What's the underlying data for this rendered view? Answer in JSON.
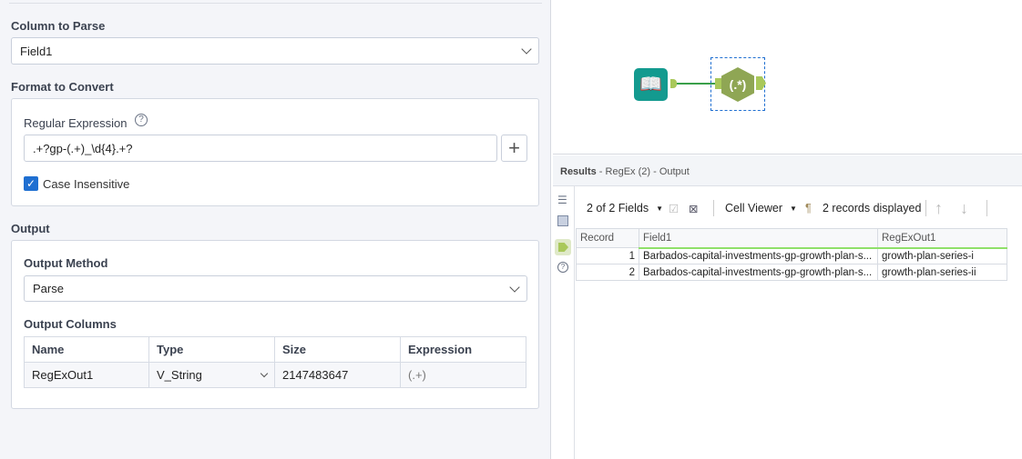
{
  "config": {
    "column_to_parse_label": "Column to Parse",
    "column_to_parse_value": "Field1",
    "format_label": "Format to Convert",
    "regex_label": "Regular Expression",
    "regex_value": ".+?gp-(.+)_\\d{4}.+?",
    "case_insensitive_label": "Case Insensitive",
    "case_insensitive_checked": true,
    "output_label": "Output",
    "output_method_label": "Output Method",
    "output_method_value": "Parse",
    "output_columns_label": "Output Columns",
    "columns_headers": [
      "Name",
      "Type",
      "Size",
      "Expression"
    ],
    "columns_rows": [
      [
        "RegExOut1",
        "V_String",
        "2147483647",
        "(.+)"
      ]
    ]
  },
  "results": {
    "title": "Results",
    "subtitle": " - RegEx (2) - Output",
    "fields_label": "2 of 2 Fields",
    "viewer_label": "Cell Viewer",
    "records_label": "2 records displayed",
    "headers": [
      "Record",
      "Field1",
      "RegExOut1"
    ],
    "rows": [
      [
        "1",
        "Barbados-capital-investments-gp-growth-plan-s...",
        "growth-plan-series-i"
      ],
      [
        "2",
        "Barbados-capital-investments-gp-growth-plan-s...",
        "growth-plan-series-ii"
      ]
    ]
  },
  "colors": {
    "accent": "#1f6fd1",
    "tool_green": "#8fa654",
    "input_teal": "#139a8f"
  }
}
